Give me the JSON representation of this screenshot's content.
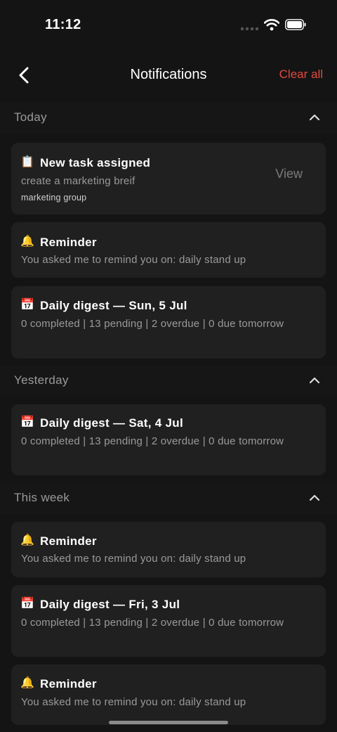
{
  "status": {
    "time": "11:12"
  },
  "header": {
    "title": "Notifications",
    "clear_label": "Clear all"
  },
  "sections": [
    {
      "title": "Today",
      "items": [
        {
          "icon": "📋",
          "title": "New task assigned",
          "body": "create a marketing breif",
          "meta": "marketing group",
          "action": "View"
        },
        {
          "icon": "🔔",
          "title": "Reminder",
          "body": "You asked me to remind you on: daily stand up"
        },
        {
          "icon": "📅",
          "title": "Daily digest — Sun, 5 Jul",
          "body": "0 completed | 13 pending | 2 overdue | 0 due tomorrow"
        }
      ]
    },
    {
      "title": "Yesterday",
      "items": [
        {
          "icon": "📅",
          "title": "Daily digest — Sat, 4 Jul",
          "body": "0 completed | 13 pending | 2 overdue | 0 due tomorrow"
        }
      ]
    },
    {
      "title": "This week",
      "items": [
        {
          "icon": "🔔",
          "title": "Reminder",
          "body": "You asked me to remind you on: daily stand up"
        },
        {
          "icon": "📅",
          "title": "Daily digest — Fri, 3 Jul",
          "body": "0 completed | 13 pending | 2 overdue | 0 due tomorrow"
        },
        {
          "icon": "🔔",
          "title": "Reminder",
          "body": "You asked me to remind you on: daily stand up"
        }
      ]
    }
  ],
  "colors": {
    "background": "#141414",
    "card": "#202020",
    "accent": "#e04a3f",
    "muted": "#9a9a9a"
  },
  "icons": {
    "back": "chevron-left-icon",
    "collapse": "chevron-up-icon",
    "task": "clipboard-icon",
    "reminder": "bell-icon",
    "digest": "calendar-icon"
  }
}
